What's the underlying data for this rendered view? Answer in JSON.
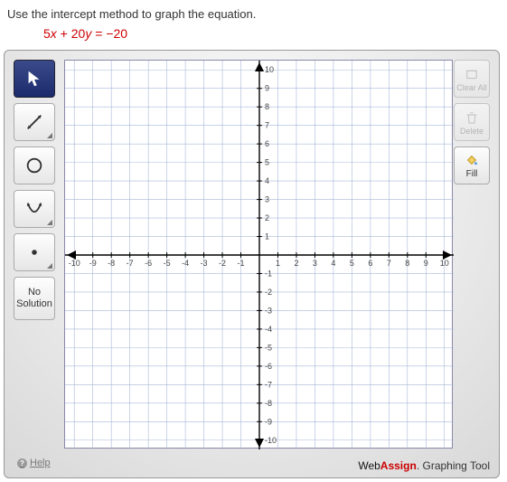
{
  "prompt": "Use the intercept method to graph the equation.",
  "equation": {
    "lhs_a": "5",
    "var1": "x",
    "plus": " + ",
    "lhs_b": "20",
    "var2": "y",
    "eq": " = ",
    "rhs": "−20"
  },
  "left_tools": {
    "pointer": "Pointer",
    "line": "Line",
    "circle": "Circle",
    "parabola": "Parabola",
    "point": "Point",
    "no_solution": "No\nSolution"
  },
  "right_tools": {
    "clear_all": "Clear All",
    "delete": "Delete",
    "fill": "Fill"
  },
  "help": "Help",
  "brand": {
    "web": "Web",
    "assign": "Assign",
    "dot": ".",
    "suffix": " Graphing Tool"
  },
  "axes": {
    "x_ticks": [
      -10,
      -9,
      -8,
      -7,
      -6,
      -5,
      -4,
      -3,
      -2,
      -1,
      1,
      2,
      3,
      4,
      5,
      6,
      7,
      8,
      9,
      10
    ],
    "y_ticks": [
      -10,
      -9,
      -8,
      -7,
      -6,
      -5,
      -4,
      -3,
      -2,
      -1,
      1,
      2,
      3,
      4,
      5,
      6,
      7,
      8,
      9,
      10
    ]
  },
  "chart_data": {
    "type": "scatter",
    "title": "",
    "xlabel": "",
    "ylabel": "",
    "xlim": [
      -10.5,
      10.5
    ],
    "ylim": [
      -10.5,
      10.5
    ],
    "grid": true,
    "series": []
  }
}
